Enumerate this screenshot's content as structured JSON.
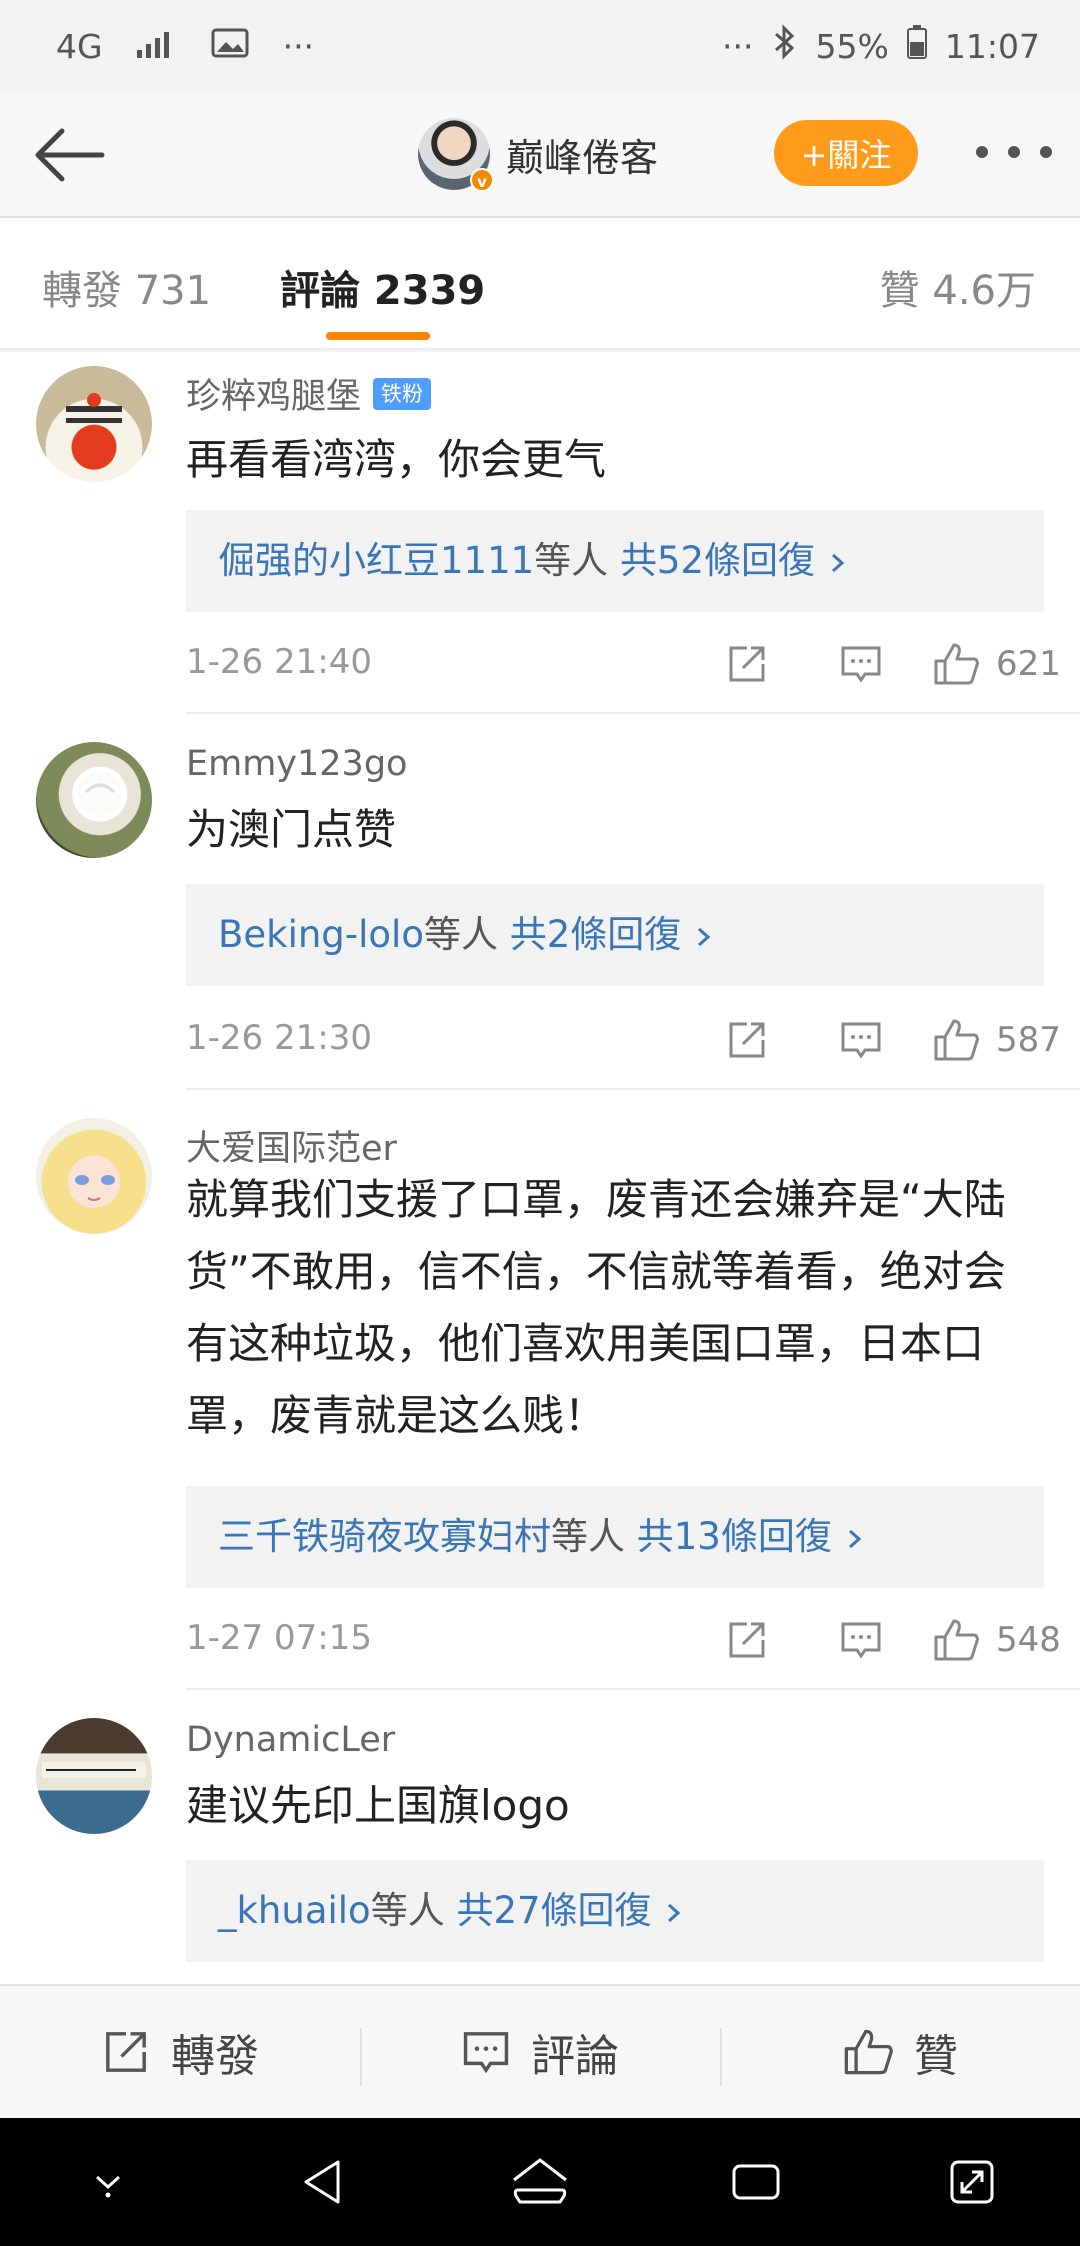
{
  "status_bar": {
    "network": "4G",
    "more": "···",
    "battery": "55%",
    "time": "11:07"
  },
  "header": {
    "author_name": "巅峰倦客",
    "follow_label": "+關注",
    "verified_badge": "v"
  },
  "tabs": {
    "repost": "轉發 731",
    "comment": "評論 2339",
    "like": "贊 4.6万"
  },
  "comments": [
    {
      "username": "珍粹鸡腿堡",
      "badge": "铁粉",
      "text": "再看看湾湾，你会更气",
      "reply_user": "倔强的小红豆1111",
      "reply_mid": "等人",
      "reply_count": "共52條回復",
      "time": "1-26 21:40",
      "likes": "621"
    },
    {
      "username": "Emmy123go",
      "text": "为澳门点赞",
      "reply_user": "Beking-lolo",
      "reply_mid": "等人",
      "reply_count": "共2條回復",
      "time": "1-26 21:30",
      "likes": "587"
    },
    {
      "username": "大爱国际范er",
      "text": "就算我们支援了口罩，废青还会嫌弃是“大陆货”不敢用，信不信，不信就等着看，绝对会有这种垃圾，他们喜欢用美国口罩，日本口罩，废青就是这么贱！",
      "reply_user": "三千铁骑夜攻寡妇村",
      "reply_mid": "等人",
      "reply_count": "共13條回復",
      "time": "1-27 07:15",
      "likes": "548"
    },
    {
      "username": "DynamicLer",
      "text": "建议先印上国旗logo",
      "reply_user": "_khuailo",
      "reply_mid": "等人",
      "reply_count": "共27條回復"
    }
  ],
  "bottom_bar": {
    "repost": "轉發",
    "comment": "評論",
    "like": "贊"
  },
  "colors": {
    "accent": "#ff8200",
    "link": "#3a76b7",
    "follow_bg": "#ff9a1a"
  }
}
